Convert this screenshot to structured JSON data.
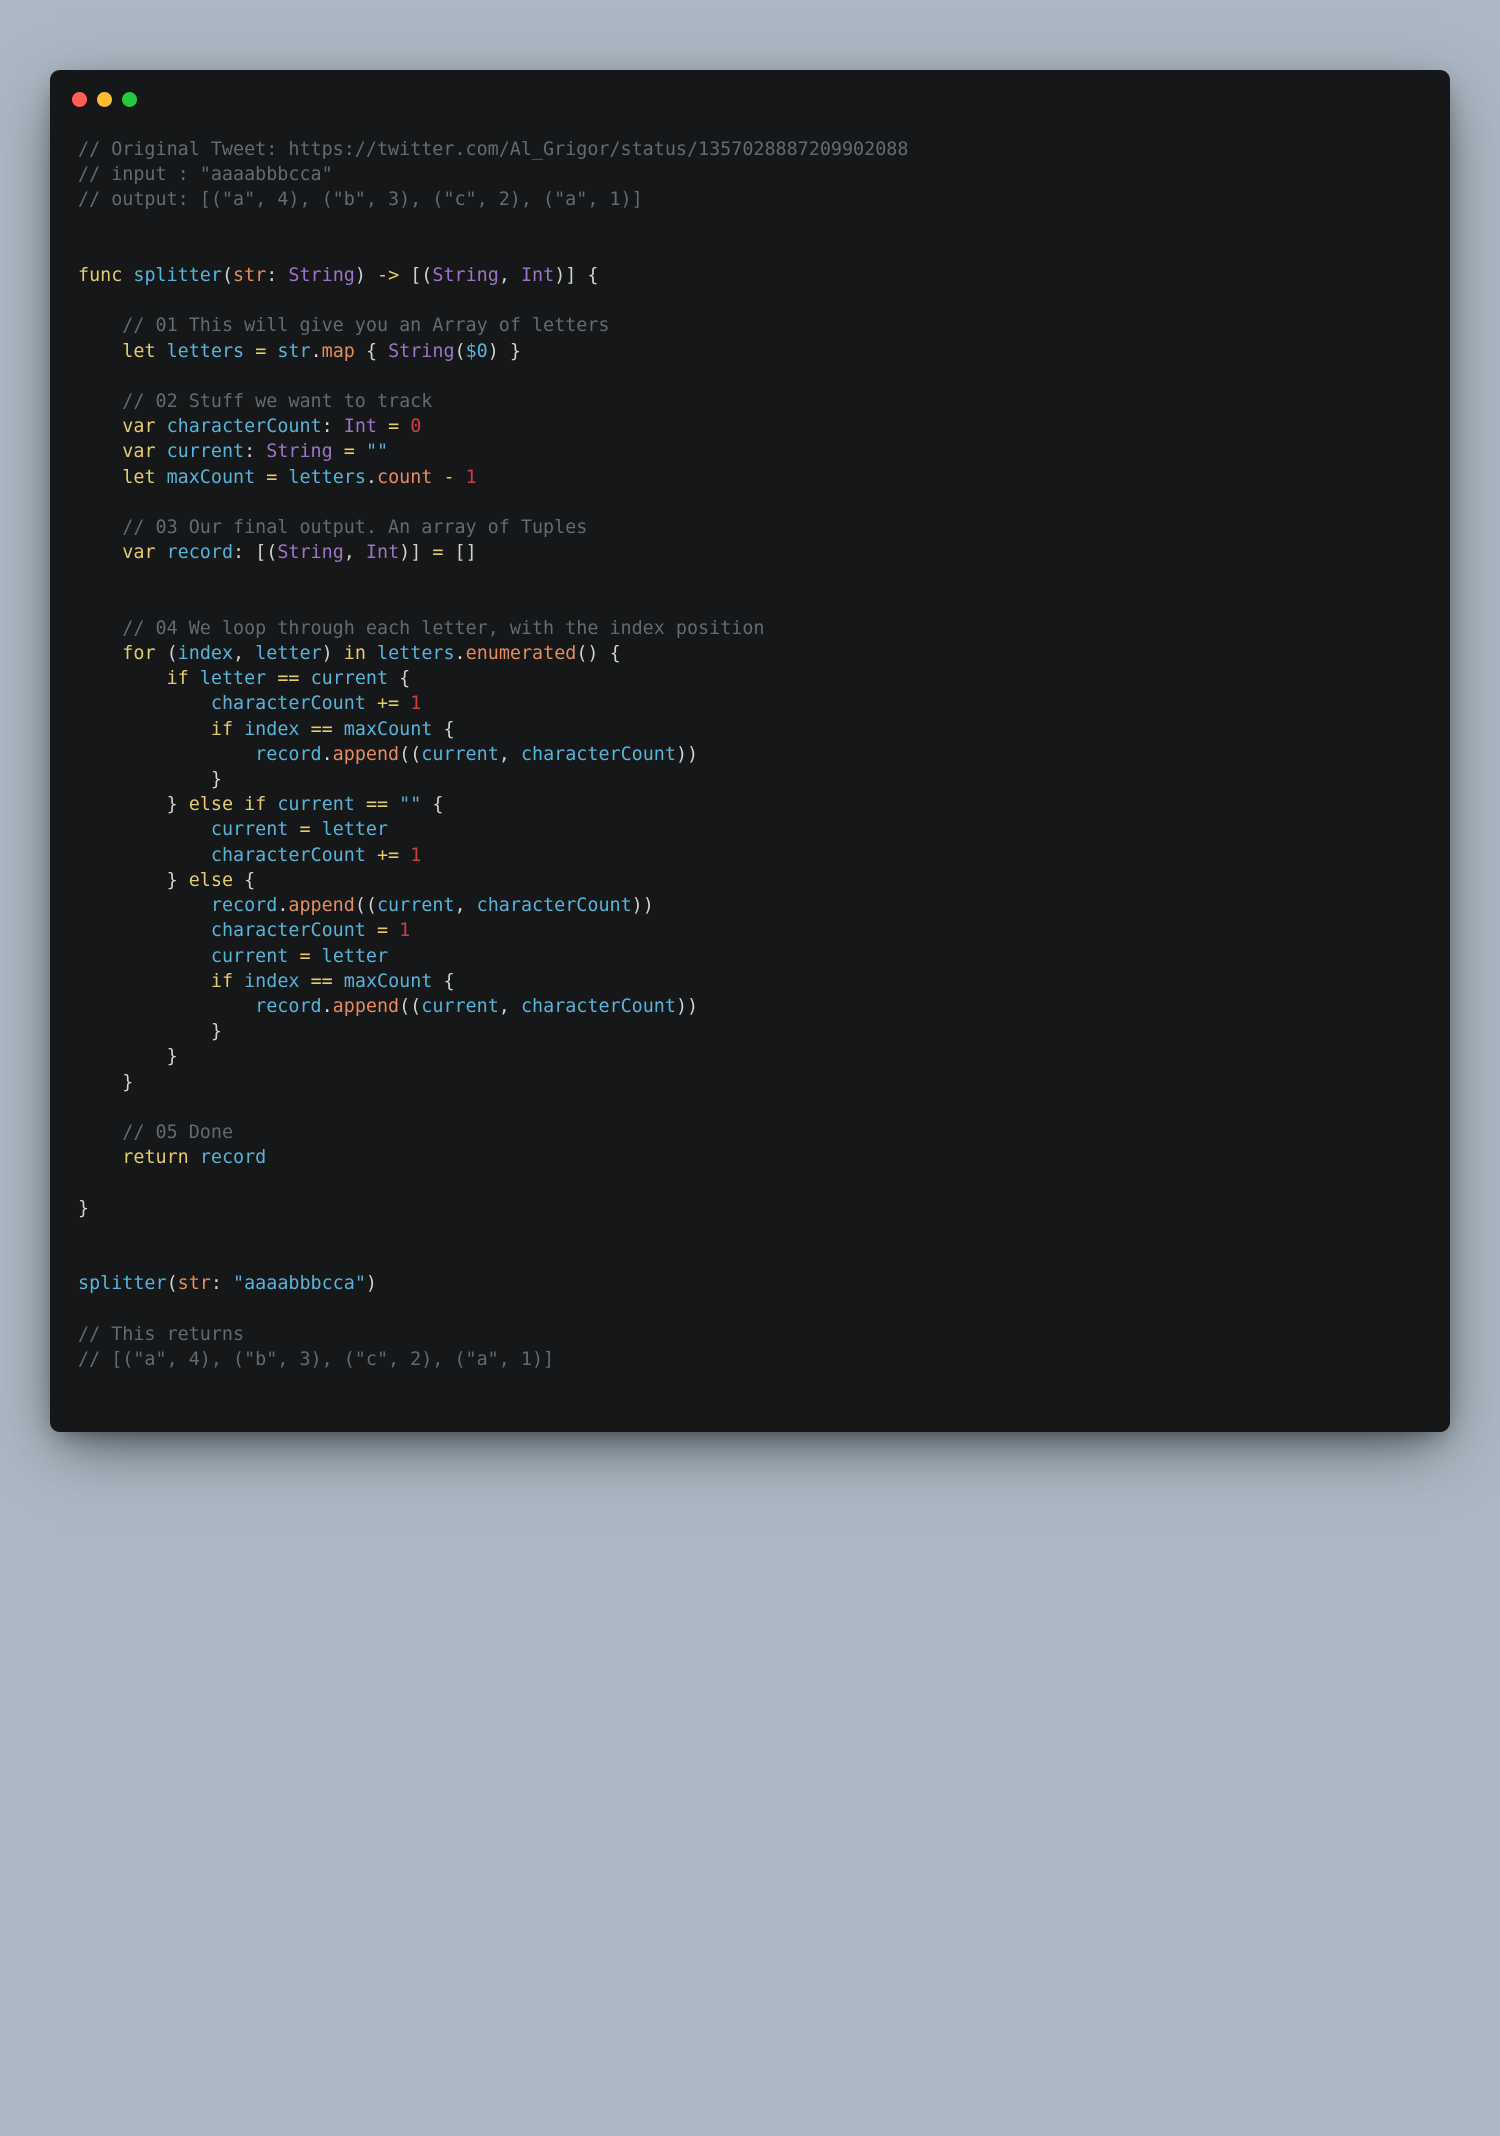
{
  "code": {
    "c1": "// Original Tweet: https://twitter.com/Al_Grigor/status/1357028887209902088",
    "c2": "// input : \"aaaabbbcca\"",
    "c3": "// output: [(\"a\", 4), (\"b\", 3), (\"c\", 2), (\"a\", 1)]",
    "kw_func": "func",
    "fn_splitter": "splitter",
    "param_str": "str",
    "type_String": "String",
    "type_Int": "Int",
    "arrow": "->",
    "c4": "// 01 This will give you an Array of letters",
    "kw_let": "let",
    "kw_var": "var",
    "id_letters": "letters",
    "id_str": "str",
    "m_map": "map",
    "dollar0": "$0",
    "c5": "// 02 Stuff we want to track",
    "id_characterCount": "characterCount",
    "num0": "0",
    "id_current": "current",
    "emptystr": "\"\"",
    "id_maxCount": "maxCount",
    "m_count": "count",
    "num1": "1",
    "c6": "// 03 Our final output. An array of Tuples",
    "id_record": "record",
    "emptyarr": "[]",
    "c7": "// 04 We loop through each letter, with the index position",
    "kw_for": "for",
    "id_index": "index",
    "id_letter": "letter",
    "kw_in": "in",
    "m_enumerated": "enumerated",
    "kw_if": "if",
    "kw_else": "else",
    "m_append": "append",
    "c8": "// 05 Done",
    "kw_return": "return",
    "call_splitter": "splitter",
    "call_label": "str",
    "call_arg": "\"aaaabbbcca\"",
    "c9": "// This returns",
    "c10": "// [(\"a\", 4), (\"b\", 3), (\"c\", 2), (\"a\", 1)]"
  }
}
